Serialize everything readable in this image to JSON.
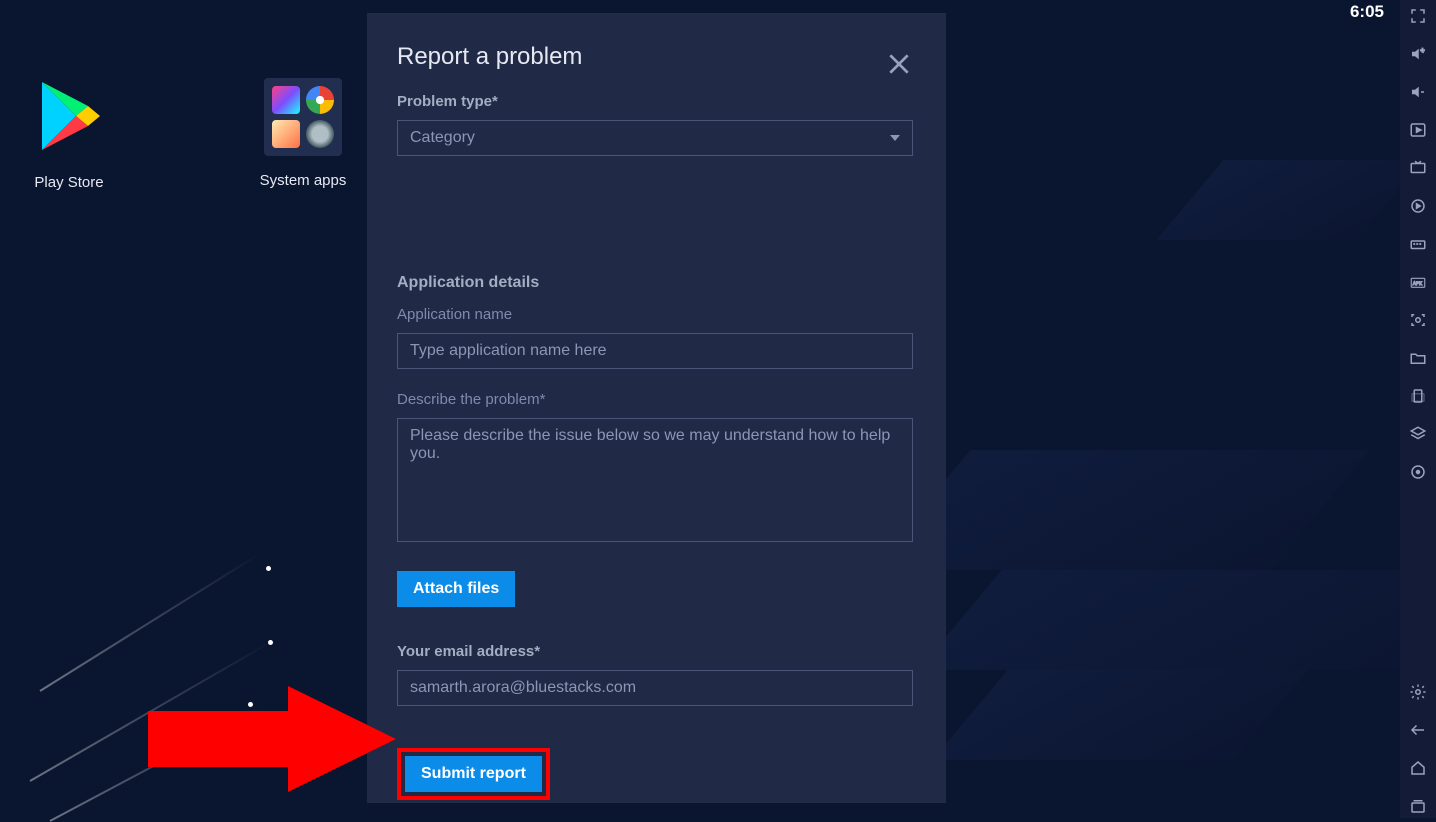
{
  "time": "6:05",
  "desktop": {
    "playstore_label": "Play Store",
    "sysapps_label": "System apps"
  },
  "modal": {
    "title": "Report a problem",
    "problem_type_label": "Problem type*",
    "category_value": "Category",
    "app_details_heading": "Application details",
    "app_name_label": "Application name",
    "app_name_placeholder": "Type application name here",
    "describe_label": "Describe the problem*",
    "describe_placeholder": "Please describe the issue below so we may understand how to help you.",
    "attach_label": "Attach files",
    "email_label": "Your email address*",
    "email_value": "samarth.arora@bluestacks.com",
    "submit_label": "Submit report"
  }
}
